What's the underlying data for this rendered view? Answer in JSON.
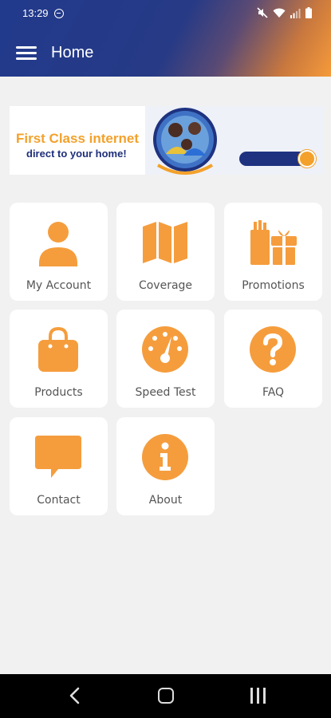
{
  "status_bar": {
    "time": "13:29",
    "icons": [
      "do-not-disturb-icon",
      "mute-icon",
      "wifi-icon",
      "signal-icon",
      "battery-icon"
    ]
  },
  "app_bar": {
    "title": "Home",
    "menu_icon": "hamburger-menu-icon",
    "gradient_colors": [
      "#223a8c",
      "#f59a3a"
    ]
  },
  "banner": {
    "headline": "First Class internet",
    "subline": "direct to your home!",
    "headline_color": "#f3a12b",
    "subline_color": "#1e2f7a"
  },
  "tiles": [
    {
      "label": "My Account",
      "icon": "user-icon"
    },
    {
      "label": "Coverage",
      "icon": "map-icon"
    },
    {
      "label": "Promotions",
      "icon": "gift-icon"
    },
    {
      "label": "Products",
      "icon": "shopping-bag-icon"
    },
    {
      "label": "Speed Test",
      "icon": "speedometer-icon"
    },
    {
      "label": "FAQ",
      "icon": "question-icon"
    },
    {
      "label": "Contact",
      "icon": "chat-bubble-icon"
    },
    {
      "label": "About",
      "icon": "info-icon"
    }
  ],
  "accent_color": "#f59d3d",
  "nav_bar": {
    "icons": [
      "back-icon",
      "home-icon",
      "recents-icon"
    ]
  }
}
